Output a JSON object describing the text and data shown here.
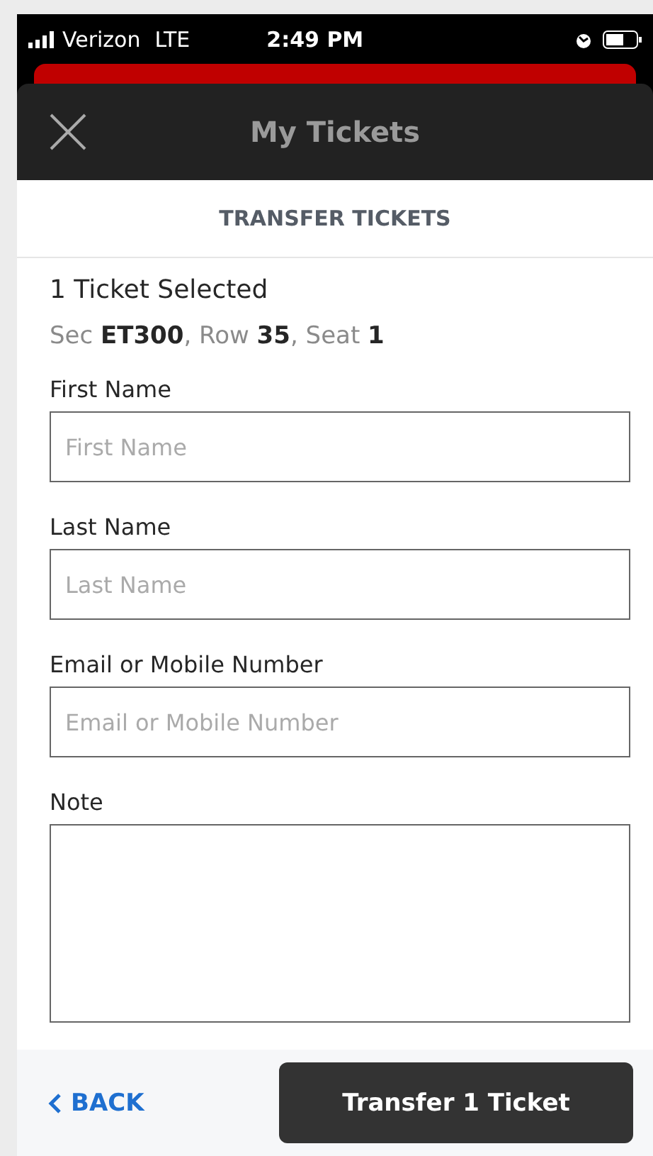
{
  "status_bar": {
    "carrier": "Verizon",
    "network": "LTE",
    "time": "2:49 PM"
  },
  "header": {
    "title": "My Tickets"
  },
  "section_title": "TRANSFER TICKETS",
  "selection": {
    "count_label": "1 Ticket Selected",
    "seat_info": "Sec **ET300**, Row **35**, Seat **1**"
  },
  "fields": [
    {
      "label": "First Name",
      "placeholder": "First Name",
      "kind": "input"
    },
    {
      "label": "Last Name",
      "placeholder": "Last Name",
      "kind": "input"
    },
    {
      "label": "Email or Mobile Number",
      "placeholder": "Email or Mobile Number",
      "kind": "input"
    },
    {
      "label": "Note",
      "kind": "textarea"
    }
  ],
  "footer": {
    "back": "BACK",
    "submit": "Transfer 1 Ticket"
  }
}
